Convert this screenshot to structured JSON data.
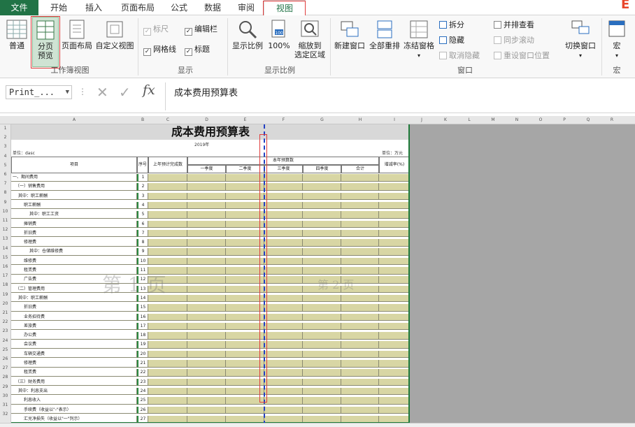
{
  "tabs": [
    "文件",
    "开始",
    "插入",
    "页面布局",
    "公式",
    "数据",
    "审阅",
    "视图"
  ],
  "active_tab": "视图",
  "ribbon": {
    "workbook_views": {
      "label": "工作簿视图",
      "normal": "普通",
      "page_break_l1": "分页",
      "page_break_l2": "预览",
      "page_layout": "页面布局",
      "custom_views": "自定义视图"
    },
    "show": {
      "label": "显示",
      "ruler": "标尺",
      "formula_bar": "编辑栏",
      "gridlines": "网格线",
      "headings": "标题"
    },
    "zoom": {
      "label": "显示比例",
      "zoom": "显示比例",
      "hundred": "100%",
      "to_selection_l1": "缩放到",
      "to_selection_l2": "选定区域"
    },
    "window": {
      "label": "窗口",
      "new_window": "新建窗口",
      "arrange_all": "全部重排",
      "freeze_panes": "冻结窗格",
      "split": "拆分",
      "hide": "隐藏",
      "unhide": "取消隐藏",
      "side_by_side": "并排查看",
      "sync_scroll": "同步滚动",
      "reset_position": "重设窗口位置",
      "switch_windows": "切换窗口"
    },
    "macros": {
      "label": "宏",
      "macros": "宏"
    }
  },
  "formula_bar": {
    "name_box": "Print_...",
    "formula": "成本费用预算表"
  },
  "sheet": {
    "columns": [
      "A",
      "B",
      "C",
      "D",
      "E",
      "F",
      "G",
      "H",
      "I",
      "J",
      "K",
      "L",
      "M",
      "N",
      "O",
      "P",
      "Q",
      "R"
    ],
    "rows": [
      "1",
      "2",
      "3",
      "4",
      "5",
      "6",
      "7",
      "8",
      "9",
      "10",
      "11",
      "12",
      "13",
      "14",
      "15",
      "16",
      "17",
      "18",
      "19",
      "20",
      "21",
      "22",
      "23",
      "24",
      "25",
      "26",
      "27",
      "28",
      "29",
      "30",
      "31",
      "32"
    ],
    "title": "成本费用预算表",
    "year": "2019年",
    "unit_left": "单位：dasc",
    "unit_right": "单位：万元",
    "header": {
      "item": "项目",
      "seq": "序号",
      "last_year": "上年预计完成数",
      "budget": "本年预算数",
      "q1": "一季度",
      "q2": "二季度",
      "q3": "三季度",
      "q4": "四季度",
      "total": "合计",
      "growth": "增减率(%)"
    },
    "watermark_page1": "第 1 页",
    "watermark_page2": "第 2 页",
    "items": [
      {
        "label": "一、期间费用",
        "seq": "1",
        "indent": 0
      },
      {
        "label": "（一）销售费用",
        "seq": "2",
        "indent": 1
      },
      {
        "label": "其中：职工薪酬",
        "seq": "3",
        "indent": 2
      },
      {
        "label": "职工薪酬",
        "seq": "4",
        "indent": 4
      },
      {
        "label": "其中：职工工资",
        "seq": "5",
        "indent": 6
      },
      {
        "label": "摊销费",
        "seq": "6",
        "indent": 4
      },
      {
        "label": "折旧费",
        "seq": "7",
        "indent": 4
      },
      {
        "label": "修理费",
        "seq": "8",
        "indent": 4
      },
      {
        "label": "其中：仓储维修费",
        "seq": "9",
        "indent": 6
      },
      {
        "label": "维修费",
        "seq": "10",
        "indent": 4
      },
      {
        "label": "租赁费",
        "seq": "11",
        "indent": 4
      },
      {
        "label": "广告费",
        "seq": "12",
        "indent": 4
      },
      {
        "label": "（二）管理费用",
        "seq": "13",
        "indent": 1
      },
      {
        "label": "其中：职工薪酬",
        "seq": "14",
        "indent": 2
      },
      {
        "label": "折旧费",
        "seq": "15",
        "indent": 4
      },
      {
        "label": "业务招待费",
        "seq": "16",
        "indent": 4
      },
      {
        "label": "差旅费",
        "seq": "17",
        "indent": 4
      },
      {
        "label": "办公费",
        "seq": "18",
        "indent": 4
      },
      {
        "label": "会议费",
        "seq": "19",
        "indent": 4
      },
      {
        "label": "车辆交通费",
        "seq": "20",
        "indent": 4
      },
      {
        "label": "修理费",
        "seq": "21",
        "indent": 4
      },
      {
        "label": "租赁费",
        "seq": "22",
        "indent": 4
      },
      {
        "label": "（三）财务费用",
        "seq": "23",
        "indent": 1
      },
      {
        "label": "其中：利息支出",
        "seq": "24",
        "indent": 2
      },
      {
        "label": "利息收入",
        "seq": "25",
        "indent": 4
      },
      {
        "label": "手续费（收益以\"-\"表示）",
        "seq": "26",
        "indent": 4
      },
      {
        "label": "汇兑净损失（收益以\"一\"列示）",
        "seq": "27",
        "indent": 4
      }
    ]
  }
}
